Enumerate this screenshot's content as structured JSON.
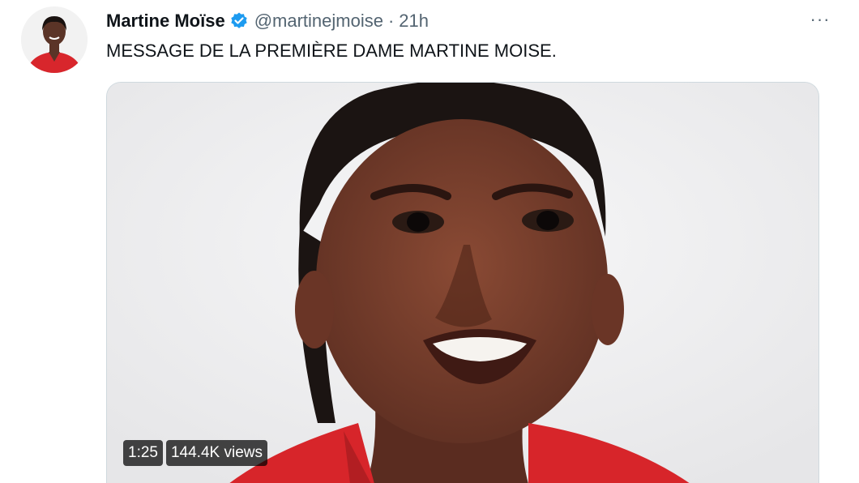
{
  "tweet": {
    "author": {
      "name": "Martine Moïse",
      "handle": "@martinejmoise",
      "verified": true
    },
    "separator": "·",
    "time": "21h",
    "more_label": "···",
    "text": "MESSAGE DE LA PREMIÈRE DAME MARTINE MOISE.",
    "video": {
      "duration": "1:25",
      "views": "144.4K views"
    }
  },
  "colors": {
    "verified_blue": "#1d9bf0",
    "secondary_text": "#536471",
    "primary_text": "#0f1419"
  },
  "icons": [
    "verified-badge-icon",
    "more-options-icon"
  ]
}
